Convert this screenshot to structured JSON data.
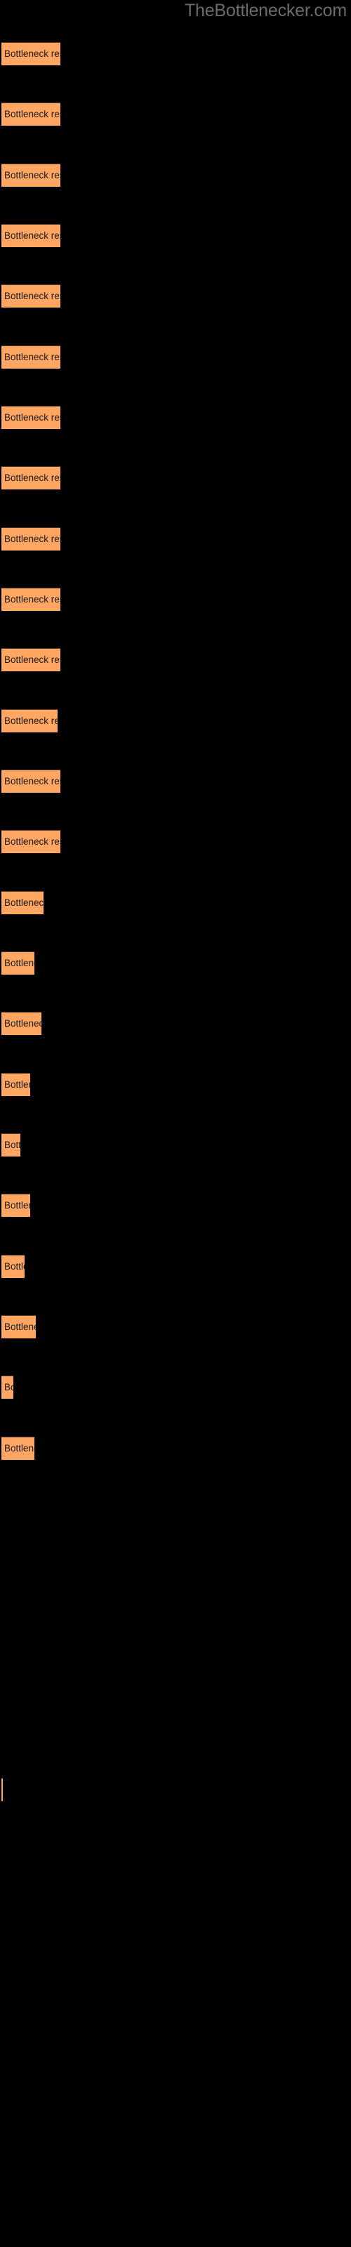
{
  "page": {
    "title": "TheBottlenecker.com",
    "background_color": "#000000",
    "title_color": "#6b6b6b"
  },
  "chart_data": {
    "type": "bar",
    "orientation": "horizontal",
    "title": "TheBottlenecker.com",
    "xlabel": "",
    "ylabel": "",
    "grid": false,
    "legend": null,
    "bar_color": "#ffa662",
    "bar_border_color": "#5a3b23",
    "label_color": "#1a1a1a",
    "xlim": [
      0,
      100
    ],
    "categories": [
      "Bottleneck result",
      "Bottleneck result",
      "Bottleneck result",
      "Bottleneck result",
      "Bottleneck result",
      "Bottleneck result",
      "Bottleneck result",
      "Bottleneck result",
      "Bottleneck result",
      "Bottleneck result",
      "Bottleneck result",
      "Bottleneck result",
      "Bottleneck result",
      "Bottleneck result",
      "Bottleneck result",
      "Bottleneck result",
      "Bottleneck result",
      "Bottleneck result",
      "Bottleneck result",
      "Bottleneck result",
      "Bottleneck result",
      "Bottleneck result",
      "Bottleneck result",
      "Bottleneck result",
      "Bottleneck result",
      "Bottleneck result"
    ],
    "values": [
      84,
      84,
      84,
      84,
      84,
      84,
      84,
      84,
      84,
      84,
      84,
      80,
      84,
      84,
      60,
      47,
      57,
      41,
      27,
      41,
      33,
      49,
      17,
      47,
      2
    ],
    "bars": [
      {
        "label": "Bottleneck result",
        "value": 84,
        "y": 60,
        "width": 84
      },
      {
        "label": "Bottleneck result",
        "value": 84,
        "y": 146,
        "width": 84
      },
      {
        "label": "Bottleneck result",
        "value": 84,
        "y": 233,
        "width": 84
      },
      {
        "label": "Bottleneck result",
        "value": 84,
        "y": 319,
        "width": 84
      },
      {
        "label": "Bottleneck result",
        "value": 84,
        "y": 405,
        "width": 84
      },
      {
        "label": "Bottleneck result",
        "value": 84,
        "y": 492,
        "width": 84
      },
      {
        "label": "Bottleneck result",
        "value": 84,
        "y": 578,
        "width": 84
      },
      {
        "label": "Bottleneck result",
        "value": 84,
        "y": 664,
        "width": 84
      },
      {
        "label": "Bottleneck result",
        "value": 84,
        "y": 751,
        "width": 84
      },
      {
        "label": "Bottleneck result",
        "value": 84,
        "y": 837,
        "width": 84
      },
      {
        "label": "Bottleneck result",
        "value": 84,
        "y": 923,
        "width": 84
      },
      {
        "label": "Bottleneck result",
        "value": 80,
        "y": 1010,
        "width": 80
      },
      {
        "label": "Bottleneck result",
        "value": 84,
        "y": 1096,
        "width": 84
      },
      {
        "label": "Bottleneck result",
        "value": 84,
        "y": 1182,
        "width": 84
      },
      {
        "label": "Bottleneck result",
        "value": 60,
        "y": 1269,
        "width": 60
      },
      {
        "label": "Bottleneck result",
        "value": 47,
        "y": 1355,
        "width": 47
      },
      {
        "label": "Bottleneck result",
        "value": 57,
        "y": 1441,
        "width": 57
      },
      {
        "label": "Bottleneck result",
        "value": 41,
        "y": 1528,
        "width": 41
      },
      {
        "label": "Bottleneck result",
        "value": 27,
        "y": 1614,
        "width": 27
      },
      {
        "label": "Bottleneck result",
        "value": 41,
        "y": 1700,
        "width": 41
      },
      {
        "label": "Bottleneck result",
        "value": 33,
        "y": 1787,
        "width": 33
      },
      {
        "label": "Bottleneck result",
        "value": 49,
        "y": 1873,
        "width": 49
      },
      {
        "label": "Bottleneck result",
        "value": 17,
        "y": 1959,
        "width": 17
      },
      {
        "label": "Bottleneck result",
        "value": 47,
        "y": 2046,
        "width": 47
      },
      {
        "label": "Bottleneck result",
        "value": 2,
        "y": 2532,
        "width": 2
      }
    ]
  }
}
